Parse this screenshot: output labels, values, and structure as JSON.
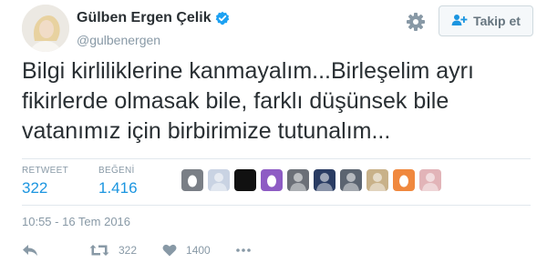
{
  "user": {
    "display_name": "Gülben Ergen Çelik",
    "handle": "@gulbenergen",
    "verified": true
  },
  "header": {
    "follow_label": "Takip et"
  },
  "tweet": {
    "text": "Bilgi kirliliklerine kanmayalım...Birleşelim ayrı fikirlerde olmasak bile, farklı düşünsek bile vatanımız için birbirimize tutunalım...",
    "timestamp": "10:55 - 16 Tem 2016"
  },
  "stats": {
    "retweet_label": "RETWEET",
    "retweet_count": "322",
    "like_label": "BEĞENİ",
    "like_count": "1.416"
  },
  "actions": {
    "retweet_count": "322",
    "like_count": "1400"
  },
  "likers": [
    {
      "color": "#7a7f86",
      "icon": "egg-avatar"
    },
    {
      "color": "#c9d3e3",
      "icon": "person-avatar"
    },
    {
      "color": "#111111",
      "icon": "dark-avatar"
    },
    {
      "color": "#8e5cc4",
      "icon": "egg-avatar"
    },
    {
      "color": "#6b6f77",
      "icon": "person-avatar"
    },
    {
      "color": "#2a3c63",
      "icon": "person-avatar"
    },
    {
      "color": "#5b6470",
      "icon": "person-avatar"
    },
    {
      "color": "#c8b189",
      "icon": "person-avatar"
    },
    {
      "color": "#f0883e",
      "icon": "egg-avatar"
    },
    {
      "color": "#e2b4b8",
      "icon": "person-avatar"
    }
  ],
  "colors": {
    "accent": "#1b95e0",
    "muted": "#8899a6",
    "text": "#292f33",
    "verified": "#1da1f2"
  }
}
